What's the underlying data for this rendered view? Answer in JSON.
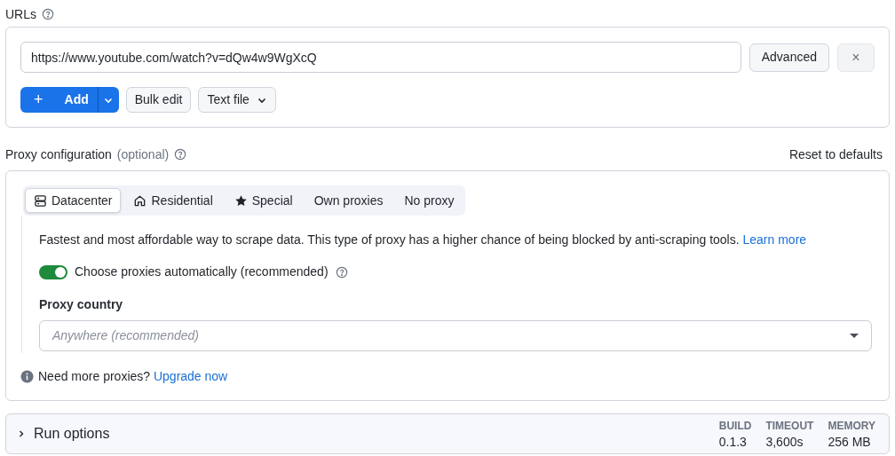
{
  "urls": {
    "label": "URLs",
    "value": "https://www.youtube.com/watch?v=dQw4w9WgXcQ",
    "advanced_button": "Advanced",
    "remove_button": "×",
    "add_button": "Add",
    "add_icon": "+",
    "bulk_edit_button": "Bulk edit",
    "text_file_button": "Text file"
  },
  "proxy": {
    "label": "Proxy configuration",
    "optional": "(optional)",
    "reset_button": "Reset to defaults",
    "tabs": [
      {
        "label": "Datacenter",
        "selected": true
      },
      {
        "label": "Residential",
        "selected": false
      },
      {
        "label": "Special",
        "selected": false
      },
      {
        "label": "Own proxies",
        "selected": false
      },
      {
        "label": "No proxy",
        "selected": false
      }
    ],
    "description": "Fastest and most affordable way to scrape data. This type of proxy has a higher chance of being blocked by anti-scraping tools.",
    "learn_more": "Learn more",
    "auto_toggle": {
      "label": "Choose proxies automatically (recommended)",
      "on": true
    },
    "country_label": "Proxy country",
    "country_placeholder": "Anywhere (recommended)",
    "note": "Need more proxies?",
    "upgrade_link": "Upgrade now"
  },
  "run_options": {
    "label": "Run options",
    "expanded": false,
    "stats": [
      {
        "label": "BUILD",
        "value": "0.1.3"
      },
      {
        "label": "TIMEOUT",
        "value": "3,600s"
      },
      {
        "label": "MEMORY",
        "value": "256 MB"
      }
    ]
  }
}
